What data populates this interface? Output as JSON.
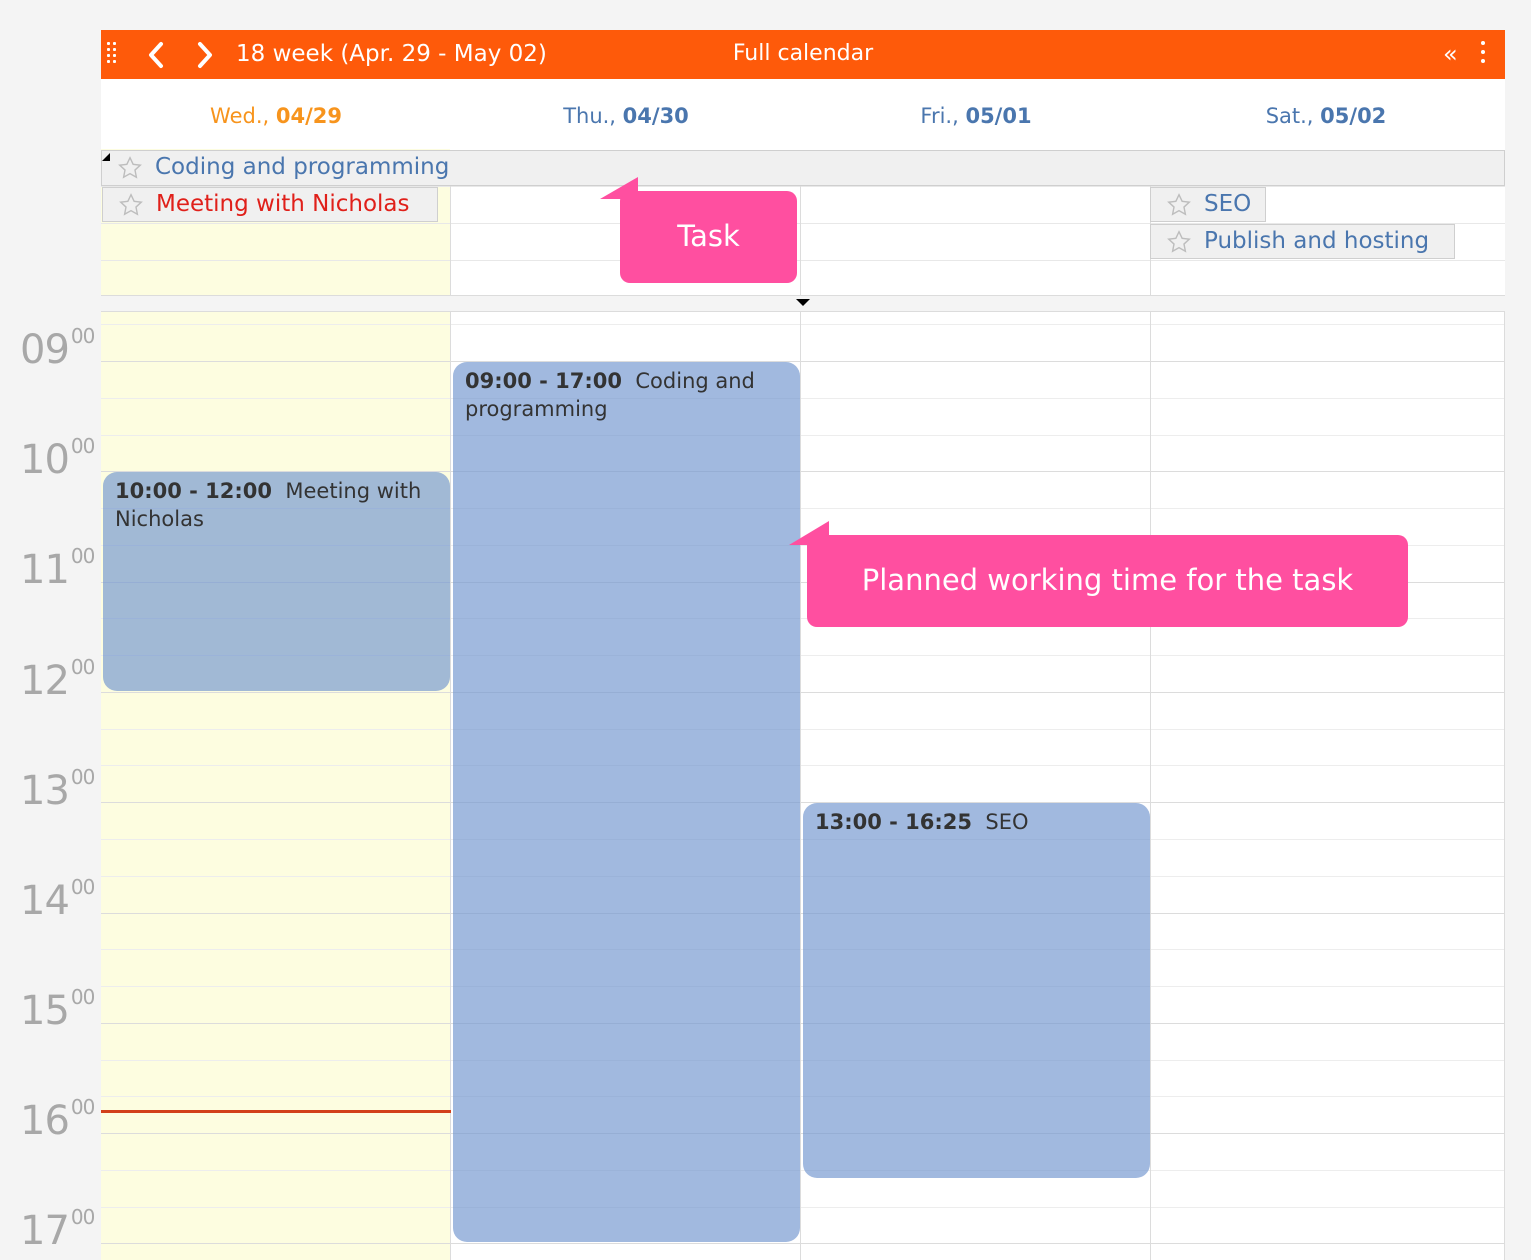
{
  "header": {
    "week_label": "18 week  (Apr. 29 - May 02)",
    "title": "Full calendar",
    "collapse_glyph": "«",
    "accent_color": "#fe5a0a"
  },
  "days": [
    {
      "prefix": "Wed., ",
      "date": "04/29",
      "today": true
    },
    {
      "prefix": "Thu., ",
      "date": "04/30",
      "today": false
    },
    {
      "prefix": "Fri., ",
      "date": "05/01",
      "today": false
    },
    {
      "prefix": "Sat., ",
      "date": "05/02",
      "today": false
    }
  ],
  "all_day": {
    "spanning_task": "Coding and programming",
    "tasks": [
      {
        "day": "04/29",
        "label": "Meeting with Nicholas",
        "color": "#e0201a"
      },
      {
        "day": "05/02",
        "label": "SEO",
        "color": "#4a76ae"
      },
      {
        "day": "05/02",
        "label": "Publish and hosting",
        "color": "#4a76ae"
      }
    ]
  },
  "time_labels": [
    {
      "h": "09",
      "m": "00"
    },
    {
      "h": "10",
      "m": "00"
    },
    {
      "h": "11",
      "m": "00"
    },
    {
      "h": "12",
      "m": "00"
    },
    {
      "h": "13",
      "m": "00"
    },
    {
      "h": "14",
      "m": "00"
    },
    {
      "h": "15",
      "m": "00"
    },
    {
      "h": "16",
      "m": "00"
    },
    {
      "h": "17",
      "m": "00"
    }
  ],
  "events": [
    {
      "day": "04/29",
      "time": "10:00 - 12:00",
      "title": "Meeting with Nicholas"
    },
    {
      "day": "04/30",
      "time": "09:00 - 17:00",
      "title": "Coding and programming"
    },
    {
      "day": "05/01",
      "time": "13:00 - 16:25",
      "title": "SEO"
    }
  ],
  "callouts": {
    "task": "Task",
    "planned": "Planned working time for the task",
    "color": "#ff4fa0"
  }
}
